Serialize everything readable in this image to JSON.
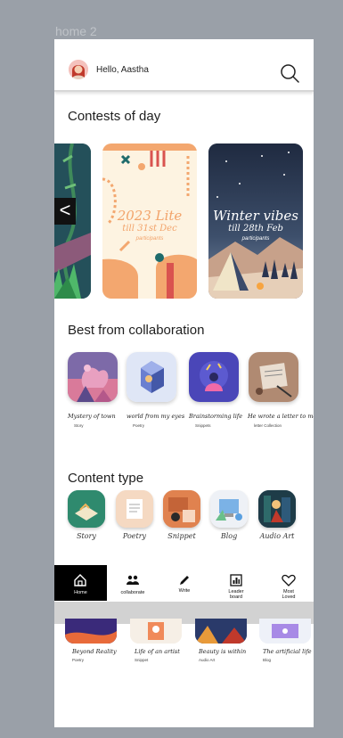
{
  "frame_label": "home 2",
  "header": {
    "greeting": "Hello, Aastha"
  },
  "contests": {
    "title": "Contests of day",
    "cards": [
      {
        "title": "2023 Lite",
        "date": "till 31st Dec",
        "subtitle": "participants"
      },
      {
        "title": "Winter vibes",
        "date": "till 28th Feb",
        "subtitle": "participants"
      }
    ],
    "prev_arrow": "<"
  },
  "collaboration": {
    "title": "Best from collaboration",
    "items": [
      {
        "title": "Mystery of town",
        "meta": "Story"
      },
      {
        "title": "world from my eyes",
        "meta": "Poetry"
      },
      {
        "title": "Brainstorming life",
        "meta": "Snippets"
      },
      {
        "title": "He wrote a letter to me",
        "meta": "letter Collection"
      }
    ]
  },
  "content_type": {
    "title": "Content type",
    "items": [
      {
        "label": "Story"
      },
      {
        "label": "Poetry"
      },
      {
        "label": "Snippet"
      },
      {
        "label": "Blog"
      },
      {
        "label": "Audio Art"
      }
    ]
  },
  "nav": {
    "items": [
      {
        "label": "Home",
        "icon": "home-icon",
        "active": true
      },
      {
        "label": "collaborate",
        "icon": "people-icon"
      },
      {
        "label": "Write",
        "icon": "pencil-icon"
      },
      {
        "label": "Leader board",
        "icon": "leaderboard-icon"
      },
      {
        "label": "Most Loved",
        "icon": "heart-icon"
      }
    ]
  },
  "more": {
    "items": [
      {
        "title": "Beyond Reality",
        "meta": "Poetry"
      },
      {
        "title": "Life of an artist",
        "meta": "Snippet"
      },
      {
        "title": "Beauty is within",
        "meta": "Audio Art"
      },
      {
        "title": "The artificial life",
        "meta": "Blog"
      }
    ]
  },
  "colors": {
    "background": "#9aa0a8",
    "nav_active": "#000000",
    "lite_bg": "#fdf3e1",
    "lite_accent": "#f3a76f",
    "winter_sky": "#2d3b55"
  }
}
